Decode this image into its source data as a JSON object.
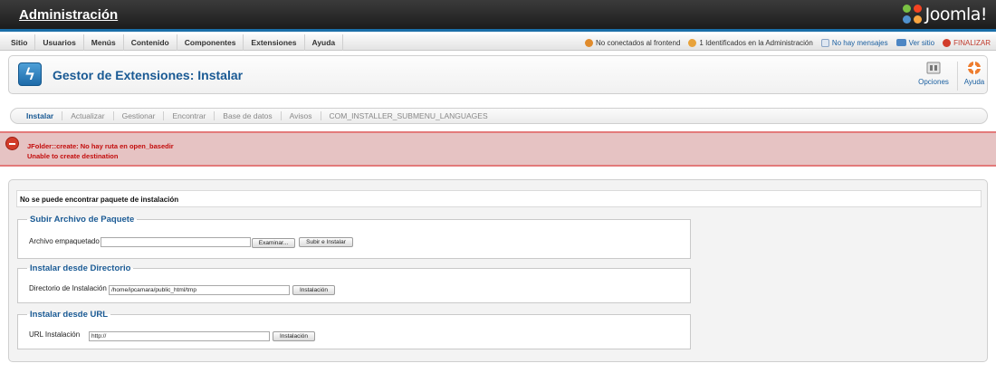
{
  "header": {
    "title": "Administración",
    "logo_text": "Joomla!"
  },
  "menu": {
    "items": [
      "Sitio",
      "Usuarios",
      "Menús",
      "Contenido",
      "Componentes",
      "Extensiones",
      "Ayuda"
    ]
  },
  "status": {
    "frontend": "No conectados al frontend",
    "admin": "1 Identificados en la Administración",
    "messages": "No hay mensajes",
    "view_site": "Ver sitio",
    "logout": "FINALIZAR"
  },
  "toolbar": {
    "title": "Gestor de Extensiones: Instalar",
    "options_label": "Opciones",
    "help_label": "Ayuda"
  },
  "subnav": {
    "items": [
      "Instalar",
      "Actualizar",
      "Gestionar",
      "Encontrar",
      "Base de datos",
      "Avisos",
      "COM_INSTALLER_SUBMENU_LANGUAGES"
    ],
    "active": "Instalar"
  },
  "error": {
    "line1": "JFolder::create: No hay ruta en open_basedir",
    "line2": "Unable to create destination"
  },
  "main": {
    "notice": "No se puede encontrar paquete de instalación",
    "upload": {
      "legend": "Subir Archivo de Paquete",
      "label": "Archivo empaquetado",
      "value": "",
      "browse_label": "Examinar...",
      "submit_label": "Subir e Instalar"
    },
    "directory": {
      "legend": "Instalar desde Directorio",
      "label": "Directorio de Instalación",
      "value": "/home/ipcamara/public_html/tmp",
      "submit_label": "Instalación"
    },
    "url": {
      "legend": "Instalar desde URL",
      "label": "URL Instalación",
      "value": "http://",
      "submit_label": "Instalación"
    }
  },
  "colors": {
    "accent": "#1a5a94",
    "error_bg": "#e6c3c3",
    "error_text": "#c30d0d"
  }
}
